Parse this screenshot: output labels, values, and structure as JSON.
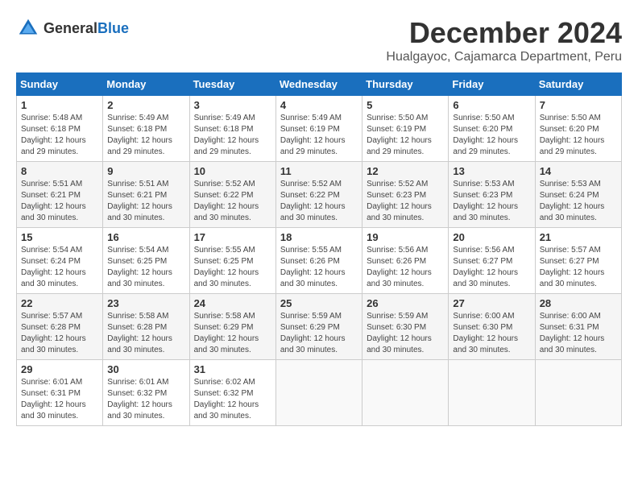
{
  "header": {
    "logo_general": "General",
    "logo_blue": "Blue",
    "month_title": "December 2024",
    "subtitle": "Hualgayoc, Cajamarca Department, Peru"
  },
  "calendar": {
    "days_of_week": [
      "Sunday",
      "Monday",
      "Tuesday",
      "Wednesday",
      "Thursday",
      "Friday",
      "Saturday"
    ],
    "weeks": [
      [
        {
          "day": "1",
          "sunrise": "5:48 AM",
          "sunset": "6:18 PM",
          "daylight": "12 hours and 29 minutes."
        },
        {
          "day": "2",
          "sunrise": "5:49 AM",
          "sunset": "6:18 PM",
          "daylight": "12 hours and 29 minutes."
        },
        {
          "day": "3",
          "sunrise": "5:49 AM",
          "sunset": "6:18 PM",
          "daylight": "12 hours and 29 minutes."
        },
        {
          "day": "4",
          "sunrise": "5:49 AM",
          "sunset": "6:19 PM",
          "daylight": "12 hours and 29 minutes."
        },
        {
          "day": "5",
          "sunrise": "5:50 AM",
          "sunset": "6:19 PM",
          "daylight": "12 hours and 29 minutes."
        },
        {
          "day": "6",
          "sunrise": "5:50 AM",
          "sunset": "6:20 PM",
          "daylight": "12 hours and 29 minutes."
        },
        {
          "day": "7",
          "sunrise": "5:50 AM",
          "sunset": "6:20 PM",
          "daylight": "12 hours and 29 minutes."
        }
      ],
      [
        {
          "day": "8",
          "sunrise": "5:51 AM",
          "sunset": "6:21 PM",
          "daylight": "12 hours and 30 minutes."
        },
        {
          "day": "9",
          "sunrise": "5:51 AM",
          "sunset": "6:21 PM",
          "daylight": "12 hours and 30 minutes."
        },
        {
          "day": "10",
          "sunrise": "5:52 AM",
          "sunset": "6:22 PM",
          "daylight": "12 hours and 30 minutes."
        },
        {
          "day": "11",
          "sunrise": "5:52 AM",
          "sunset": "6:22 PM",
          "daylight": "12 hours and 30 minutes."
        },
        {
          "day": "12",
          "sunrise": "5:52 AM",
          "sunset": "6:23 PM",
          "daylight": "12 hours and 30 minutes."
        },
        {
          "day": "13",
          "sunrise": "5:53 AM",
          "sunset": "6:23 PM",
          "daylight": "12 hours and 30 minutes."
        },
        {
          "day": "14",
          "sunrise": "5:53 AM",
          "sunset": "6:24 PM",
          "daylight": "12 hours and 30 minutes."
        }
      ],
      [
        {
          "day": "15",
          "sunrise": "5:54 AM",
          "sunset": "6:24 PM",
          "daylight": "12 hours and 30 minutes."
        },
        {
          "day": "16",
          "sunrise": "5:54 AM",
          "sunset": "6:25 PM",
          "daylight": "12 hours and 30 minutes."
        },
        {
          "day": "17",
          "sunrise": "5:55 AM",
          "sunset": "6:25 PM",
          "daylight": "12 hours and 30 minutes."
        },
        {
          "day": "18",
          "sunrise": "5:55 AM",
          "sunset": "6:26 PM",
          "daylight": "12 hours and 30 minutes."
        },
        {
          "day": "19",
          "sunrise": "5:56 AM",
          "sunset": "6:26 PM",
          "daylight": "12 hours and 30 minutes."
        },
        {
          "day": "20",
          "sunrise": "5:56 AM",
          "sunset": "6:27 PM",
          "daylight": "12 hours and 30 minutes."
        },
        {
          "day": "21",
          "sunrise": "5:57 AM",
          "sunset": "6:27 PM",
          "daylight": "12 hours and 30 minutes."
        }
      ],
      [
        {
          "day": "22",
          "sunrise": "5:57 AM",
          "sunset": "6:28 PM",
          "daylight": "12 hours and 30 minutes."
        },
        {
          "day": "23",
          "sunrise": "5:58 AM",
          "sunset": "6:28 PM",
          "daylight": "12 hours and 30 minutes."
        },
        {
          "day": "24",
          "sunrise": "5:58 AM",
          "sunset": "6:29 PM",
          "daylight": "12 hours and 30 minutes."
        },
        {
          "day": "25",
          "sunrise": "5:59 AM",
          "sunset": "6:29 PM",
          "daylight": "12 hours and 30 minutes."
        },
        {
          "day": "26",
          "sunrise": "5:59 AM",
          "sunset": "6:30 PM",
          "daylight": "12 hours and 30 minutes."
        },
        {
          "day": "27",
          "sunrise": "6:00 AM",
          "sunset": "6:30 PM",
          "daylight": "12 hours and 30 minutes."
        },
        {
          "day": "28",
          "sunrise": "6:00 AM",
          "sunset": "6:31 PM",
          "daylight": "12 hours and 30 minutes."
        }
      ],
      [
        {
          "day": "29",
          "sunrise": "6:01 AM",
          "sunset": "6:31 PM",
          "daylight": "12 hours and 30 minutes."
        },
        {
          "day": "30",
          "sunrise": "6:01 AM",
          "sunset": "6:32 PM",
          "daylight": "12 hours and 30 minutes."
        },
        {
          "day": "31",
          "sunrise": "6:02 AM",
          "sunset": "6:32 PM",
          "daylight": "12 hours and 30 minutes."
        },
        null,
        null,
        null,
        null
      ]
    ]
  }
}
